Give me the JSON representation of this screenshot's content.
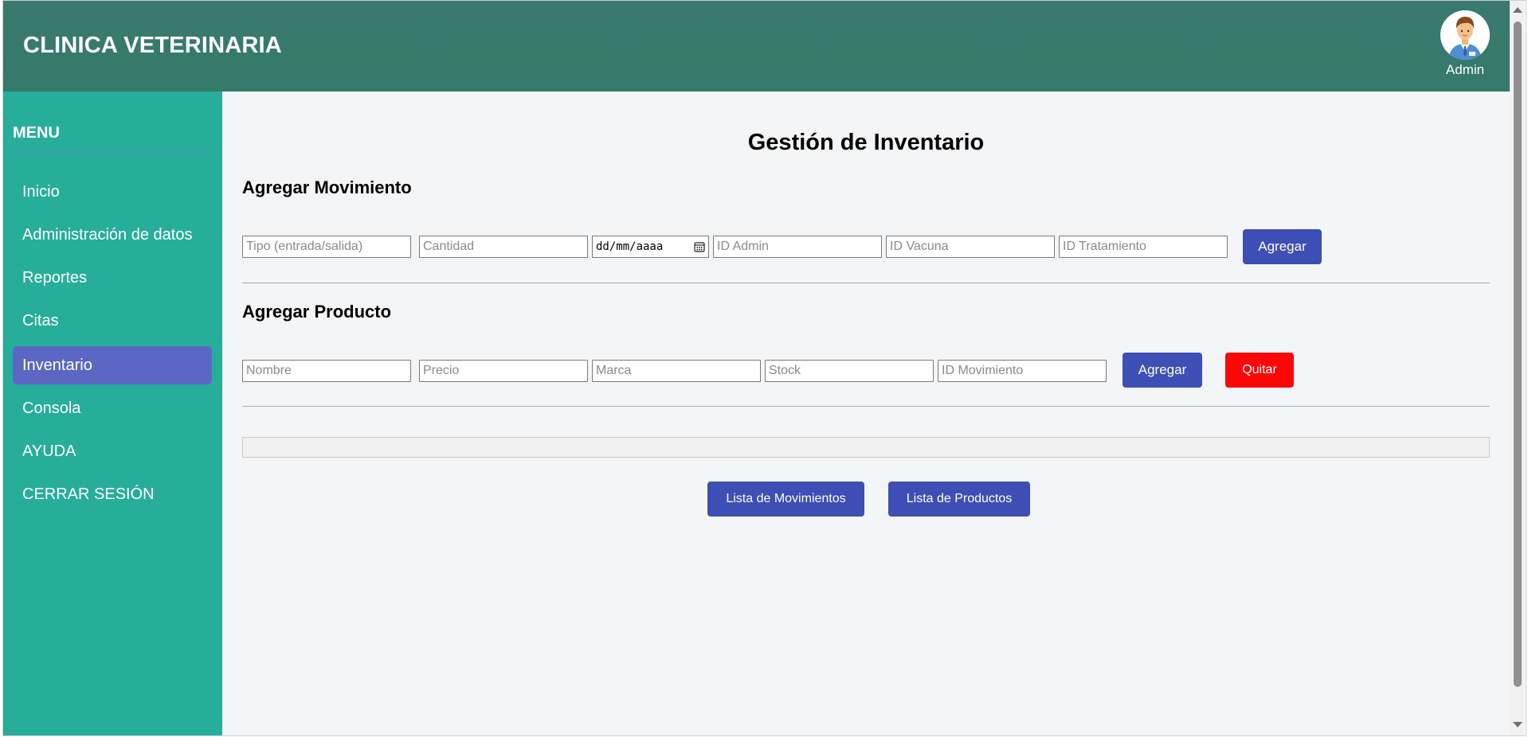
{
  "header": {
    "title": "CLINICA VETERINARIA",
    "user_label": "Admin",
    "avatar_icon": "user-avatar-icon"
  },
  "sidebar": {
    "menu_title": "MENU",
    "items": [
      {
        "label": "Inicio",
        "active": false
      },
      {
        "label": "Administración de datos",
        "active": false
      },
      {
        "label": "Reportes",
        "active": false
      },
      {
        "label": "Citas",
        "active": false
      },
      {
        "label": "Inventario",
        "active": true
      },
      {
        "label": "Consola",
        "active": false
      },
      {
        "label": "AYUDA",
        "active": false
      },
      {
        "label": "CERRAR SESIÓN",
        "active": false
      }
    ]
  },
  "main": {
    "page_title": "Gestión de Inventario",
    "movement_section": {
      "title": "Agregar Movimiento",
      "fields": {
        "tipo": {
          "placeholder": "Tipo (entrada/salida)",
          "value": ""
        },
        "cantidad": {
          "placeholder": "Cantidad",
          "value": ""
        },
        "fecha": {
          "value": "dd/mm/aaaa"
        },
        "id_admin": {
          "placeholder": "ID Admin",
          "value": ""
        },
        "id_vacuna": {
          "placeholder": "ID Vacuna",
          "value": ""
        },
        "id_tratamiento": {
          "placeholder": "ID Tratamiento",
          "value": ""
        }
      },
      "add_label": "Agregar"
    },
    "product_section": {
      "title": "Agregar Producto",
      "fields": {
        "nombre": {
          "placeholder": "Nombre",
          "value": ""
        },
        "precio": {
          "placeholder": "Precio",
          "value": ""
        },
        "marca": {
          "placeholder": "Marca",
          "value": ""
        },
        "stock": {
          "placeholder": "Stock",
          "value": ""
        },
        "id_movimiento": {
          "placeholder": "ID Movimiento",
          "value": ""
        }
      },
      "add_label": "Agregar",
      "remove_label": "Quitar"
    },
    "list_buttons": {
      "movements_label": "Lista de Movimientos",
      "products_label": "Lista de Productos"
    }
  },
  "colors": {
    "header_bg": "#36796b",
    "sidebar_bg": "#26ae9b",
    "active_item_bg": "#5c67c4",
    "primary_button": "#3d4fb5",
    "danger_button": "#fb0707",
    "content_bg": "#f4f5f7"
  }
}
